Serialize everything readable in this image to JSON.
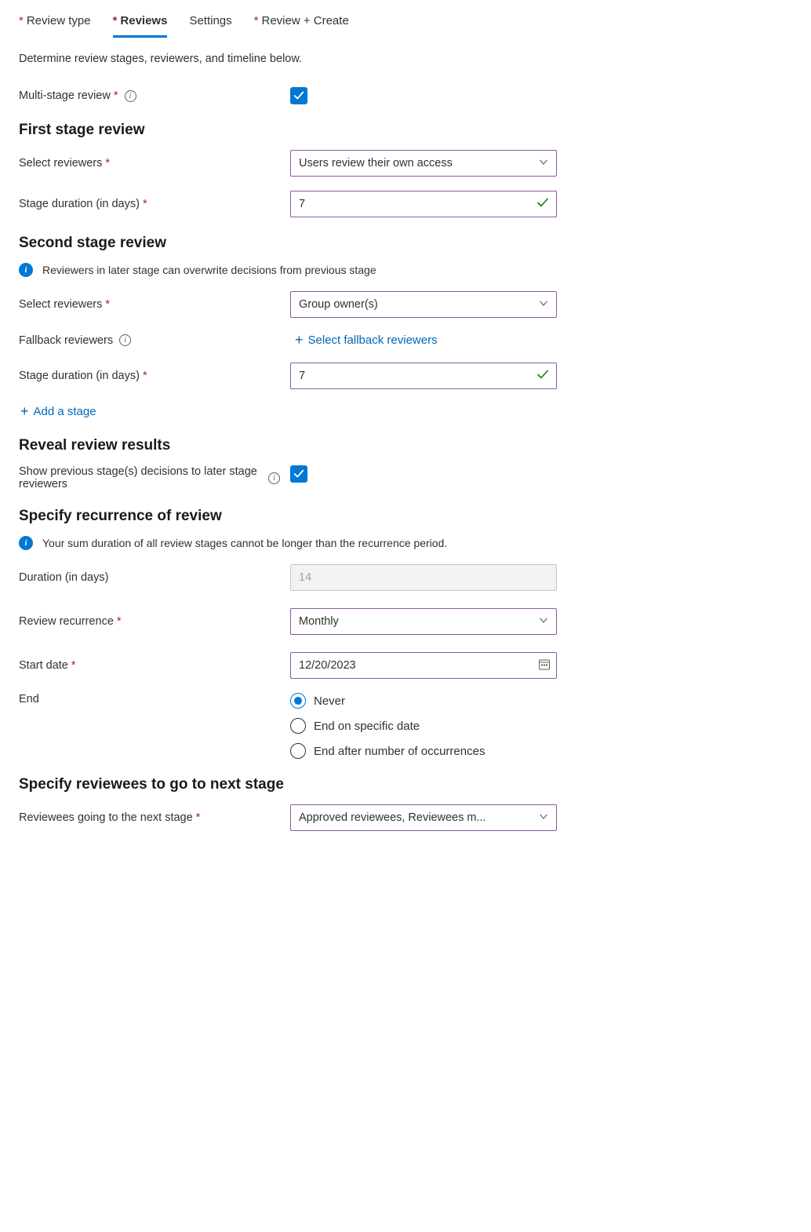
{
  "tabs": {
    "review_type": "Review type",
    "reviews": "Reviews",
    "settings": "Settings",
    "review_create": "Review + Create"
  },
  "intro": "Determine review stages, reviewers, and timeline below.",
  "labels": {
    "multi_stage": "Multi-stage review",
    "first_stage_title": "First stage review",
    "select_reviewers": "Select reviewers",
    "stage_duration": "Stage duration (in days)",
    "second_stage_title": "Second stage review",
    "later_stage_info": "Reviewers in later stage can overwrite decisions from previous stage",
    "fallback_reviewers": "Fallback reviewers",
    "select_fallback_link": "Select fallback reviewers",
    "add_stage": "Add a stage",
    "reveal_title": "Reveal review results",
    "show_prev_decisions": "Show previous stage(s) decisions to later stage reviewers",
    "recurrence_title": "Specify recurrence of review",
    "recurrence_info": "Your sum duration of all review stages cannot be longer than the recurrence period.",
    "duration_days": "Duration (in days)",
    "review_recurrence": "Review recurrence",
    "start_date": "Start date",
    "end": "End",
    "end_options": {
      "never": "Never",
      "specific": "End on specific date",
      "occurrences": "End after number of occurrences"
    },
    "reviewees_title": "Specify reviewees to go to next stage",
    "reviewees_next": "Reviewees going to the next stage"
  },
  "values": {
    "first_reviewers": "Users review their own access",
    "first_duration": "7",
    "second_reviewers": "Group owner(s)",
    "second_duration": "7",
    "total_duration": "14",
    "recurrence": "Monthly",
    "start_date": "12/20/2023",
    "reviewees_next": "Approved reviewees, Reviewees m..."
  },
  "colors": {
    "primary": "#0078d4",
    "required": "#a4262c",
    "border_focus": "#8b5a9e"
  }
}
